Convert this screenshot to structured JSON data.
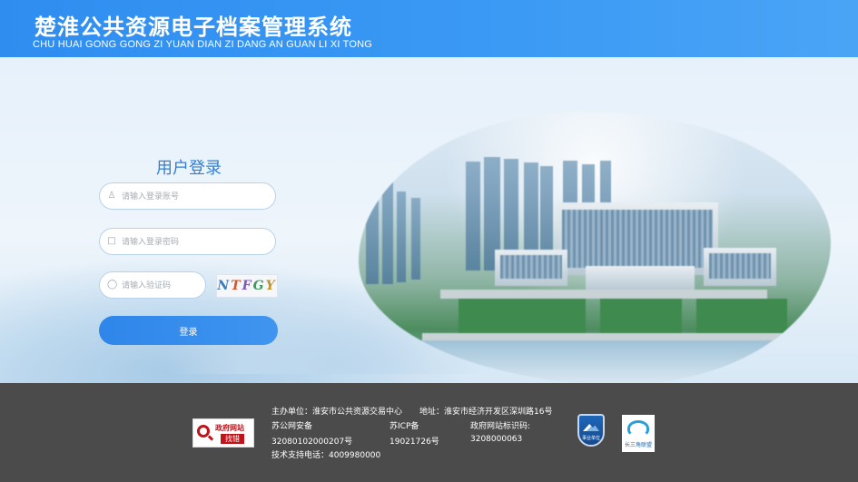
{
  "header": {
    "title_cn": "楚淮公共资源电子档案管理系统",
    "title_en": "CHU HUAI GONG GONG ZI YUAN DIAN ZI DANG AN GUAN LI XI TONG"
  },
  "login": {
    "title": "用户登录",
    "username_placeholder": "请输入登录账号",
    "password_placeholder": "请输入登录密码",
    "captcha_placeholder": "请输入验证码",
    "captcha_text": [
      "N",
      "T",
      "F",
      "G",
      "Y"
    ],
    "submit_label": "登录"
  },
  "footer": {
    "sponsor": "主办单位：淮安市公共资源交易中心",
    "address": "地址：淮安市经济开发区深圳路16号",
    "police_label": "苏公网安备",
    "police_number": "32080102000207号",
    "icp_label": "苏ICP备",
    "icp_number": "19021726号",
    "gov_code_label": "政府网站标识码:",
    "gov_code_number": "3208000063",
    "support": "技术支持电话：4009980000",
    "badge_find_line1": "政府网站",
    "badge_find_line2": "找错",
    "badge_shield_text": "事业单位",
    "badge_csj_text": "长三角联盟"
  },
  "colors": {
    "header_blue": "#3b9af4",
    "button_blue": "#2f86ea",
    "footer_gray": "#4b4b4b",
    "login_title": "#2f7fd6"
  }
}
